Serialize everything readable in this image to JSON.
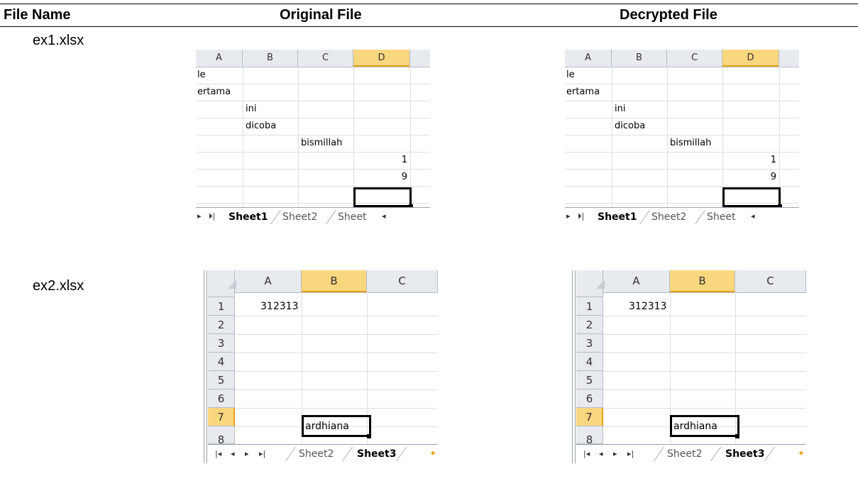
{
  "header": {
    "file_name": "File Name",
    "original_file": "Original File",
    "decrypted_file": "Decrypted File"
  },
  "rows": [
    {
      "file": "ex1.xlsx",
      "sheet": {
        "columns": [
          "A",
          "B",
          "C",
          "D"
        ],
        "selected_column": "D",
        "cells": {
          "r1_a": "le",
          "r2_a": "ertama",
          "r3_b": "ini",
          "r4_b": "dicoba",
          "r5_c": "bismillah",
          "r6_d": "1",
          "r7_d": "9"
        },
        "nav": [
          "▸",
          "⏵|"
        ],
        "tabs": [
          "Sheet1",
          "Sheet2",
          "Sheet"
        ],
        "active_tab": "Sheet1"
      }
    },
    {
      "file": "ex2.xlsx",
      "sheet": {
        "columns": [
          "A",
          "B",
          "C"
        ],
        "selected_column": "B",
        "row_numbers": [
          "1",
          "2",
          "3",
          "4",
          "5",
          "6",
          "7",
          "8"
        ],
        "selected_row": "7",
        "cells": {
          "r1_a": "312313",
          "r7_b": "ardhiana"
        },
        "nav": [
          "|◂",
          "◂",
          "▸",
          "▸|"
        ],
        "tabs": [
          "Sheet2",
          "Sheet3"
        ],
        "active_tab": "Sheet3"
      }
    }
  ]
}
